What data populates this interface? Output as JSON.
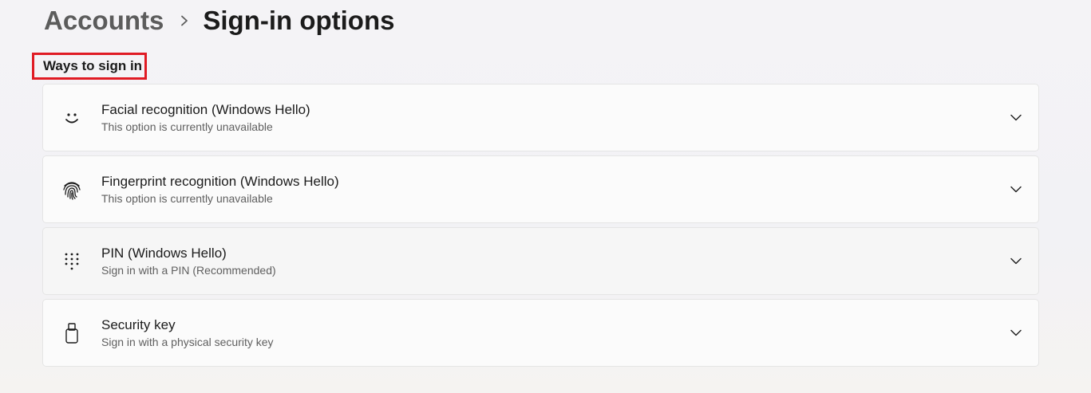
{
  "breadcrumb": {
    "parent": "Accounts",
    "current": "Sign-in options"
  },
  "section": {
    "title": "Ways to sign in"
  },
  "options": [
    {
      "title": "Facial recognition (Windows Hello)",
      "subtitle": "This option is currently unavailable",
      "icon": "smile-face-icon"
    },
    {
      "title": "Fingerprint recognition (Windows Hello)",
      "subtitle": "This option is currently unavailable",
      "icon": "fingerprint-icon"
    },
    {
      "title": "PIN (Windows Hello)",
      "subtitle": "Sign in with a PIN (Recommended)",
      "icon": "keypad-icon"
    },
    {
      "title": "Security key",
      "subtitle": "Sign in with a physical security key",
      "icon": "usb-key-icon"
    }
  ],
  "colors": {
    "highlight_border": "#e01b24",
    "card_background": "#fbfbfb",
    "page_background": "#f3f3f5"
  }
}
